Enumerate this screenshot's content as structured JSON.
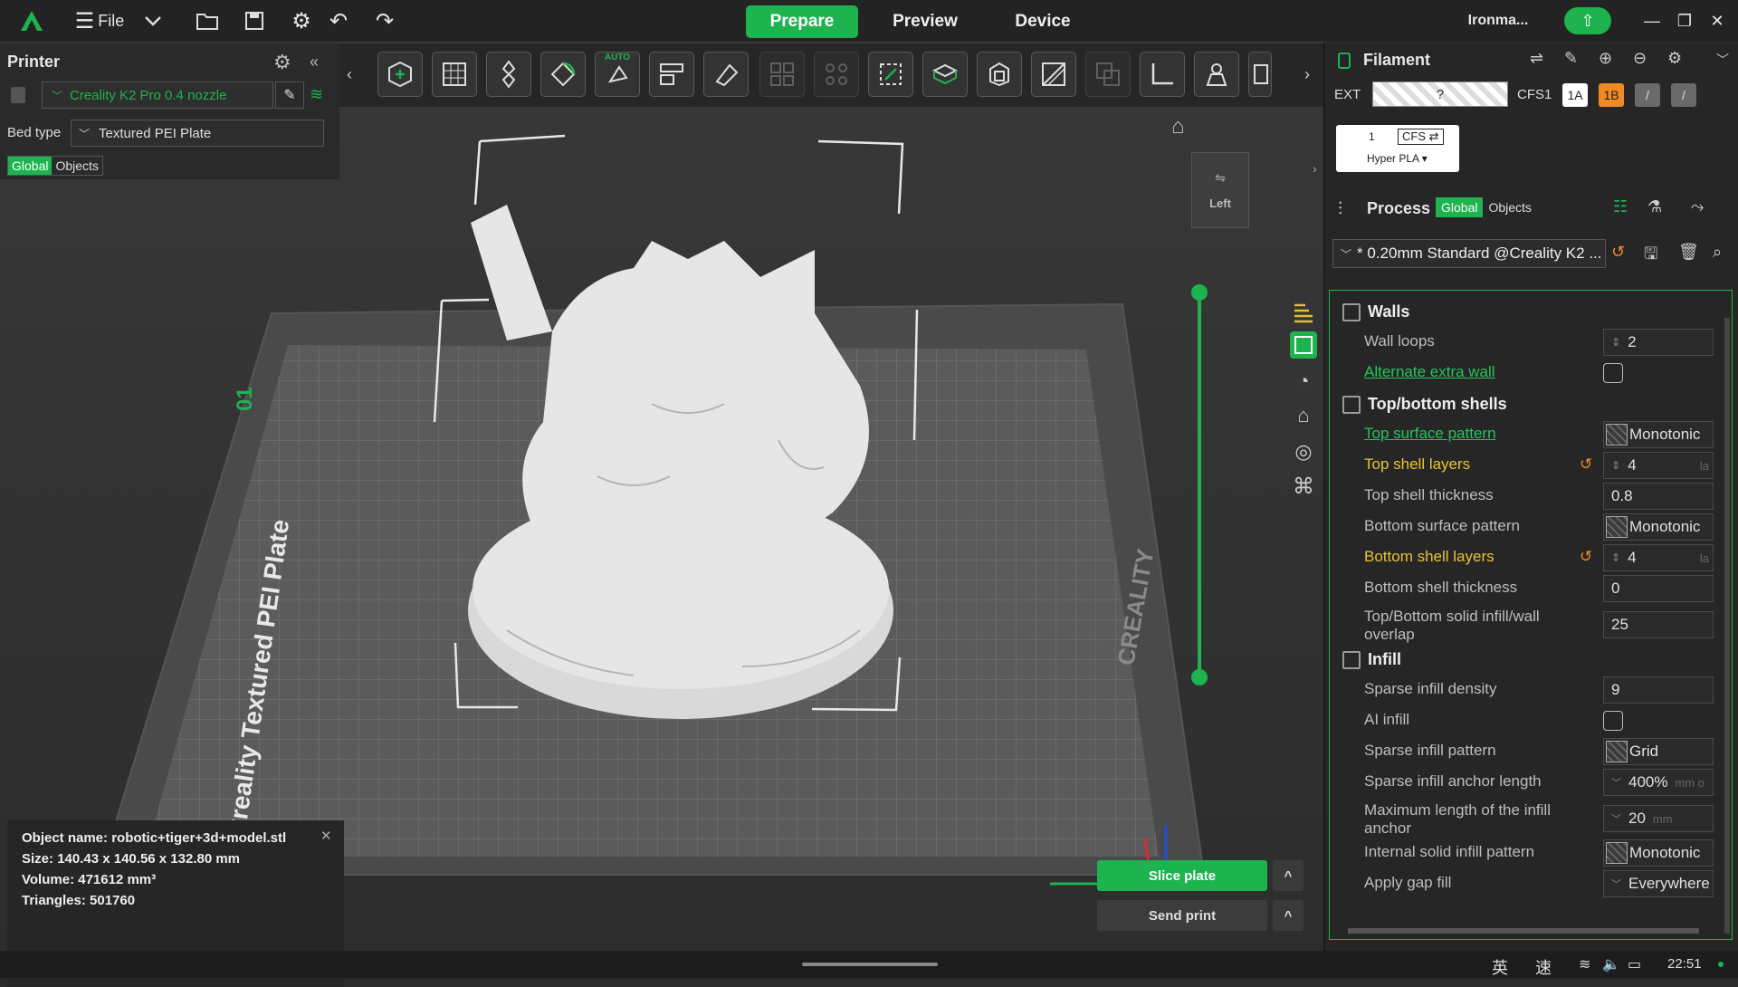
{
  "app": {
    "logo": "creality-print-logo",
    "file_menu": "File",
    "user": "Ironma...",
    "time": "22:51"
  },
  "tabs": [
    {
      "label": "Prepare",
      "active": true
    },
    {
      "label": "Preview",
      "active": false
    },
    {
      "label": "Device",
      "active": false
    }
  ],
  "printer": {
    "title": "Printer",
    "name": "Creality K2 Pro 0.4 nozzle",
    "bed_type_label": "Bed type",
    "bed_type": "Textured PEI Plate",
    "seg_global": "Global",
    "seg_objects": "Objects"
  },
  "toolbar": {
    "auto_label": "AUTO"
  },
  "viewport": {
    "view_label": "Left",
    "plate_text": "Creality Textured PEI Plate",
    "brand_text": "CREALITY",
    "object_name_label": "Object name:",
    "object_name": "robotic+tiger+3d+model.stl",
    "size_label": "Size:",
    "size": "140.43 x 140.56 x 132.80 mm",
    "volume_label": "Volume:",
    "volume": "471612 mm³",
    "triangles_label": "Triangles:",
    "triangles": "501760",
    "slice_button": "Slice plate",
    "send_button": "Send print"
  },
  "filament": {
    "title": "Filament",
    "ext_label": "EXT",
    "ext_value": "?",
    "cfs_label": "CFS1",
    "slot_1a": "1A",
    "slot_1b": "1B",
    "slot_blank1": "/",
    "slot_blank2": "/",
    "card_index": "1",
    "card_cfs": "CFS ⇄",
    "card_type": "Hyper PLA ▾"
  },
  "process": {
    "title": "Process",
    "seg_global": "Global",
    "seg_objects": "Objects",
    "preset": "* 0.20mm Standard @Creality K2 ..."
  },
  "settings": [
    {
      "type": "section",
      "label": "Walls"
    },
    {
      "type": "num",
      "label": "Wall loops",
      "value": "2",
      "style": "normal"
    },
    {
      "type": "check",
      "label": "Alternate extra wall",
      "style": "green"
    },
    {
      "type": "section",
      "label": "Top/bottom shells"
    },
    {
      "type": "pattern",
      "label": "Top surface pattern",
      "value": "Monotonic",
      "style": "green"
    },
    {
      "type": "num",
      "label": "Top shell layers",
      "value": "4",
      "unit": "la",
      "style": "yellow",
      "reset": true
    },
    {
      "type": "text",
      "label": "Top shell thickness",
      "value": "0.8",
      "style": "normal"
    },
    {
      "type": "pattern",
      "label": "Bottom surface pattern",
      "value": "Monotonic",
      "style": "normal"
    },
    {
      "type": "num",
      "label": "Bottom shell layers",
      "value": "4",
      "unit": "la",
      "style": "yellow",
      "reset": true
    },
    {
      "type": "text",
      "label": "Bottom shell thickness",
      "value": "0",
      "style": "normal"
    },
    {
      "type": "text2",
      "label": "Top/Bottom solid infill/wall overlap",
      "value": "25",
      "style": "normal"
    },
    {
      "type": "section",
      "label": "Infill"
    },
    {
      "type": "text",
      "label": "Sparse infill density",
      "value": "9",
      "style": "normal"
    },
    {
      "type": "check",
      "label": "AI infill",
      "style": "normal"
    },
    {
      "type": "pattern",
      "label": "Sparse infill pattern",
      "value": "Grid",
      "style": "normal"
    },
    {
      "type": "drop",
      "label": "Sparse infill anchor length",
      "value": "400%",
      "unit": "mm o",
      "style": "normal"
    },
    {
      "type": "drop2",
      "label": "Maximum length of the infill anchor",
      "value": "20",
      "unit": "mm",
      "style": "normal"
    },
    {
      "type": "pattern",
      "label": "Internal solid infill pattern",
      "value": "Monotonic",
      "style": "normal"
    },
    {
      "type": "drop",
      "label": "Apply gap fill",
      "value": "Everywhere",
      "style": "normal"
    }
  ],
  "taskbar": {
    "ime1": "英",
    "ime2": "速"
  }
}
